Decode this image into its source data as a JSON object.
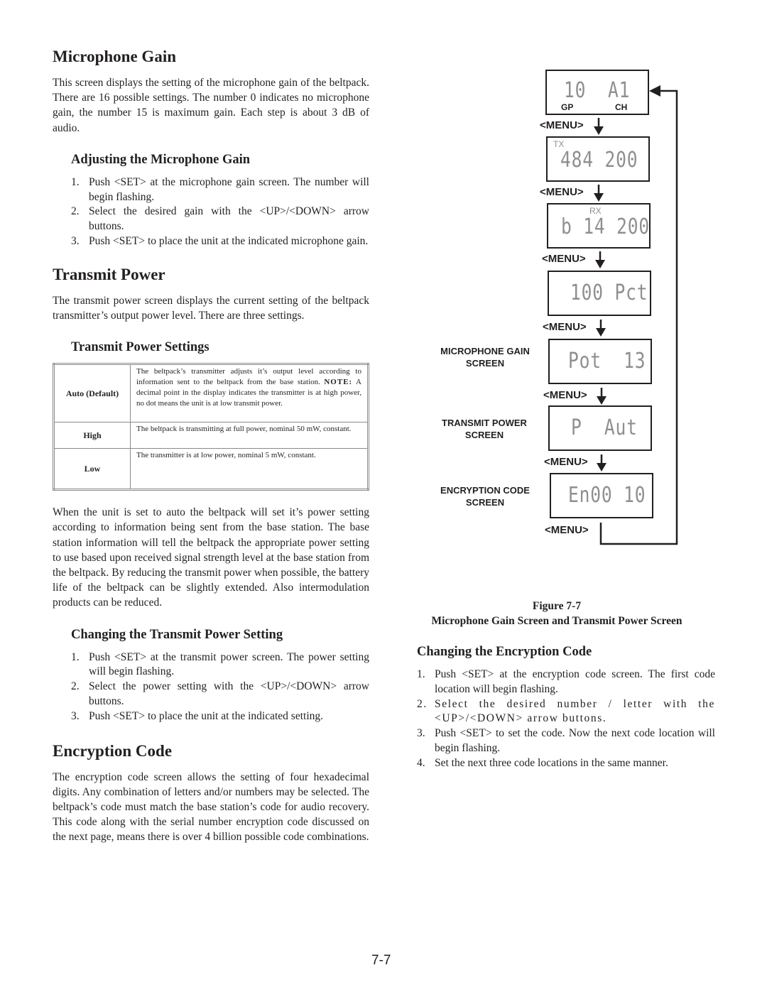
{
  "mic_gain": {
    "title": "Microphone Gain",
    "intro": "This screen displays the setting of the microphone gain of the beltpack. There are 16 possible settings. The number 0 indicates no microphone gain, the number 15 is maximum gain. Each step is about 3 dB of audio.",
    "adjust_heading": "Adjusting the Microphone Gain",
    "adjust_steps": [
      {
        "num": "1.",
        "text": "Push <SET> at the microphone gain screen. The number will begin flashing."
      },
      {
        "num": "2.",
        "text": "Select the desired gain with the <UP>/<DOWN> arrow buttons."
      },
      {
        "num": "3.",
        "text": "Push <SET> to place the unit at the indicated microphone gain."
      }
    ]
  },
  "transmit_power": {
    "title": "Transmit Power",
    "intro": "The transmit power screen displays the current setting of the beltpack transmitter’s output power level. There are three settings.",
    "settings_heading": "Transmit Power Settings",
    "table": [
      {
        "label": "Auto (Default)",
        "desc": "The beltpack’s transmitter adjusts it’s output level according to information sent to the beltpack from the base station.",
        "note_label": "NOTE:",
        "note": "A decimal point in the display indicates the transmitter is at high power, no dot means the unit is at low transmit power."
      },
      {
        "label": "High",
        "desc": "The beltpack is transmitting at full power, nominal 50 mW, constant."
      },
      {
        "label": "Low",
        "desc": "The transmitter is at low power, nominal 5 mW, constant."
      }
    ],
    "auto_para": "When the unit is set to auto the beltpack will set it’s power setting according to information being sent from the base station. The base station information will tell the beltpack the appropriate power setting to use based upon received signal strength level at the base station from the beltpack. By reducing the transmit power when possible, the battery life of the beltpack can be slightly extended. Also intermodulation products can be reduced.",
    "change_heading": "Changing the Transmit Power Setting",
    "change_steps": [
      {
        "num": "1.",
        "text": "Push <SET> at the transmit power screen. The power setting will begin flashing."
      },
      {
        "num": "2.",
        "text": "Select the power setting with the <UP>/<DOWN> arrow buttons."
      },
      {
        "num": "3.",
        "text": "Push <SET> to place the unit at the indicated setting."
      }
    ]
  },
  "encryption": {
    "title": "Encryption Code",
    "intro": "The encryption code screen allows the setting of four hexadecimal digits. Any combination of letters and/or numbers may be selected. The beltpack’s code must match the base station’s code for audio recovery. This code along with the serial number encryption code discussed on the next page, means there is over 4 billion possible code combinations.",
    "change_heading": "Changing the Encryption Code",
    "change_steps": [
      {
        "num": "1.",
        "text": "Push <SET> at the encryption code screen. The first code location will begin flashing."
      },
      {
        "num": "2.",
        "text": "Select the desired number / letter with the <UP>/<DOWN> arrow buttons."
      },
      {
        "num": "3.",
        "text": "Push <SET> to set the code. Now the next code location will begin flashing."
      },
      {
        "num": "4.",
        "text": "Set the next three code locations in the same manner."
      }
    ]
  },
  "diagram": {
    "menu_label": "<MENU>",
    "screens": [
      {
        "display_left": "10",
        "display_right": "A1",
        "sub_left": "GP",
        "sub_right": "CH"
      },
      {
        "tag": "TX",
        "display": "484 200"
      },
      {
        "tag": "RX",
        "display": "b 14 200"
      },
      {
        "display": "100 Pct"
      },
      {
        "display": "Pot  13",
        "side_label": "MICROPHONE GAIN SCREEN"
      },
      {
        "display": "P  Aut",
        "side_label": "TRANSMIT POWER SCREEN"
      },
      {
        "display": "En00 10",
        "side_label": "ENCRYPTION CODE SCREEN"
      }
    ]
  },
  "figure": {
    "number": "Figure 7-7",
    "caption": "Microphone Gain Screen and Transmit Power Screen"
  },
  "page_number": "7-7"
}
